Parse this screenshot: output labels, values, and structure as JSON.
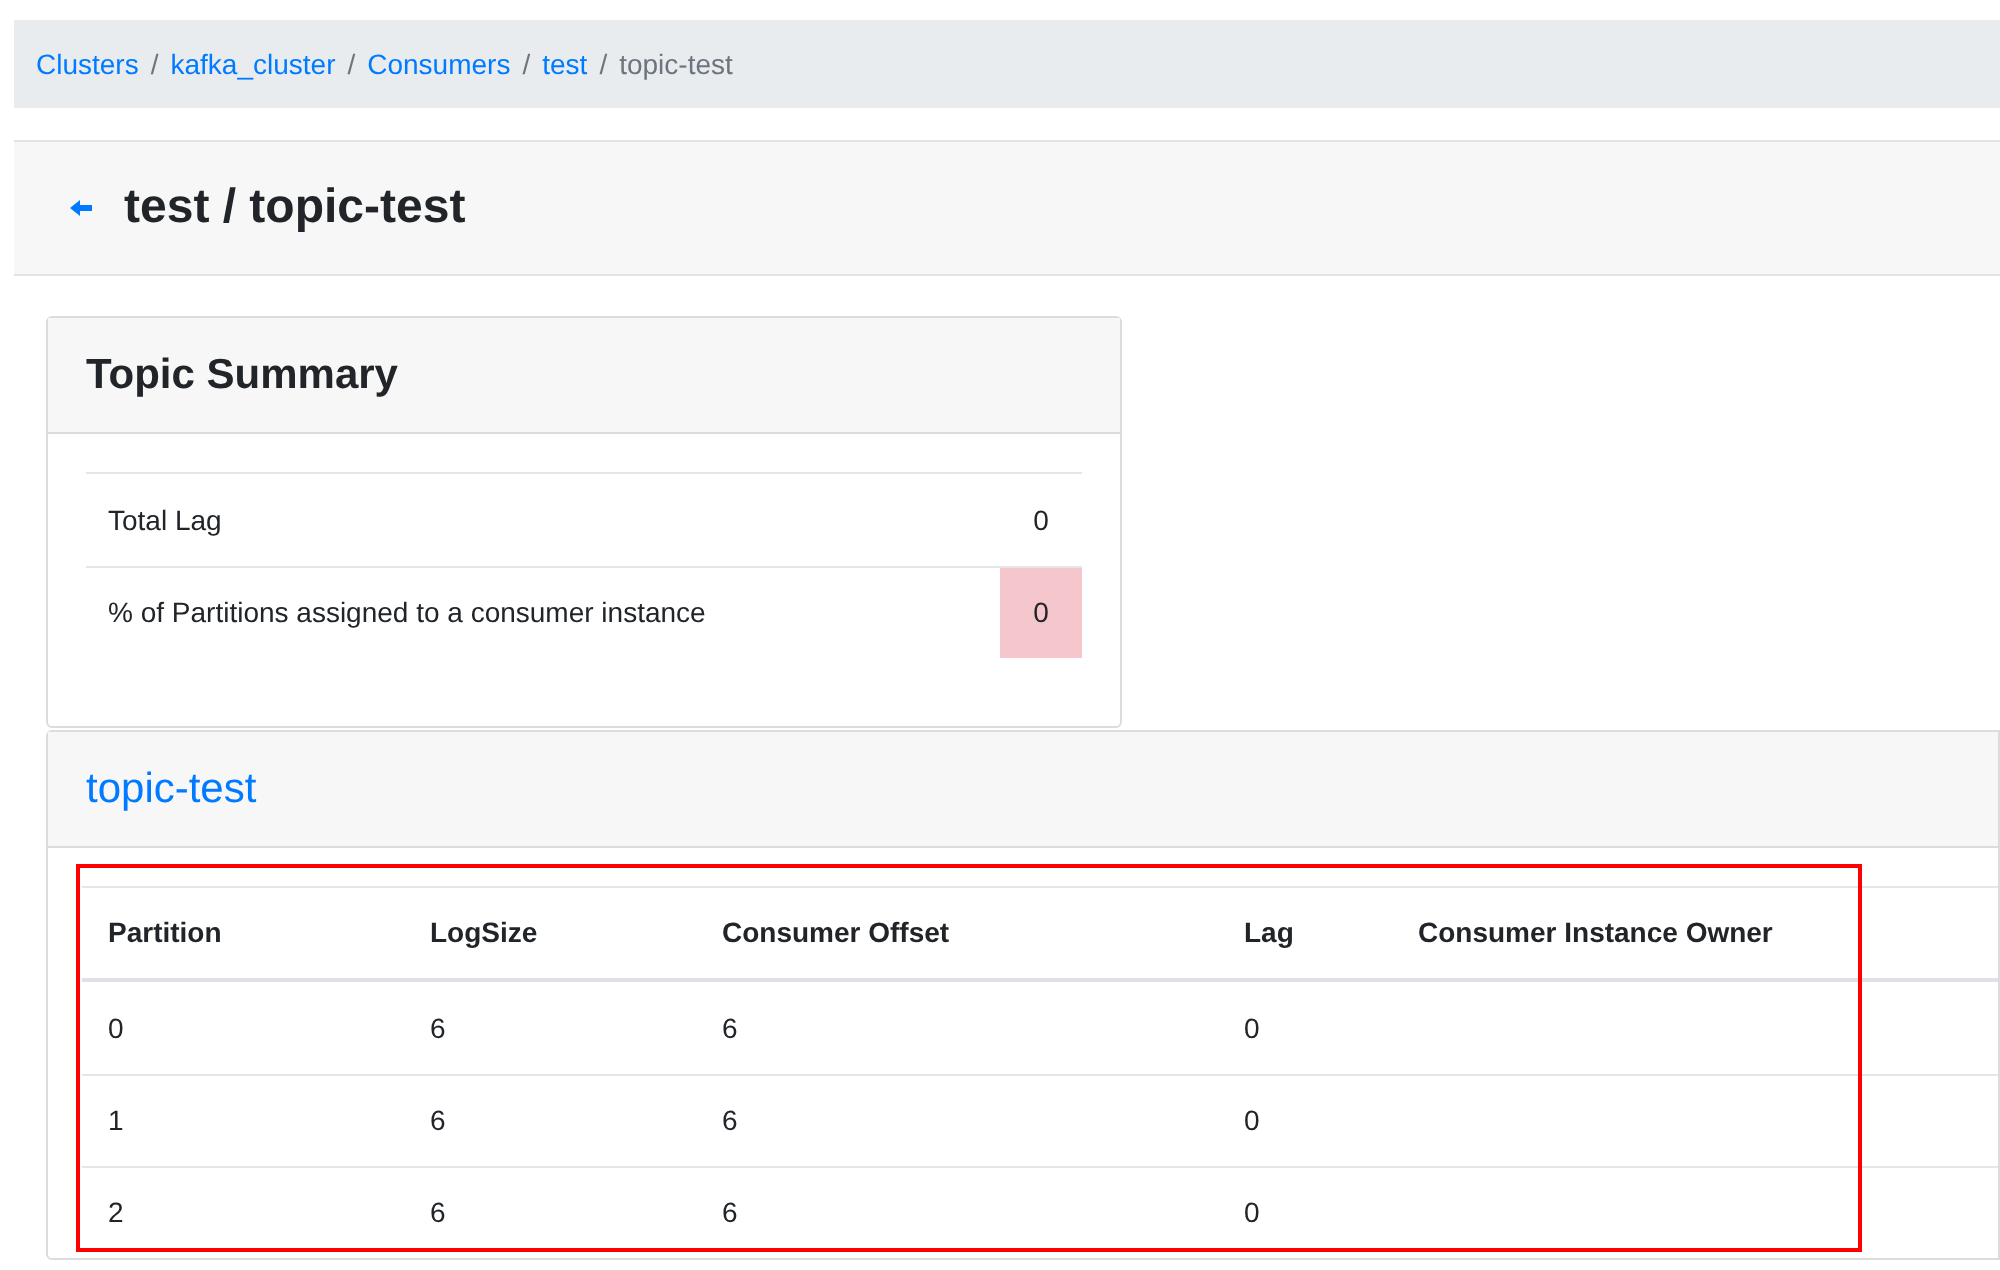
{
  "breadcrumb": [
    {
      "label": "Clusters",
      "link": true
    },
    {
      "label": "kafka_cluster",
      "link": true
    },
    {
      "label": "Consumers",
      "link": true
    },
    {
      "label": "test",
      "link": true
    },
    {
      "label": "topic-test",
      "link": false
    }
  ],
  "breadcrumb_separator": "/",
  "page_title": "test / topic-test",
  "summary": {
    "title": "Topic Summary",
    "rows": [
      {
        "label": "Total Lag",
        "value": "0",
        "danger": false
      },
      {
        "label": "% of Partitions assigned to a consumer instance",
        "value": "0",
        "danger": true
      }
    ]
  },
  "topic": {
    "title": "topic-test",
    "highlighted": true,
    "columns": [
      "Partition",
      "LogSize",
      "Consumer Offset",
      "Lag",
      "Consumer Instance Owner"
    ],
    "rows": [
      [
        "0",
        "6",
        "6",
        "0"
      ],
      [
        "1",
        "6",
        "6",
        "0"
      ],
      [
        "2",
        "6",
        "6",
        "0"
      ]
    ]
  }
}
